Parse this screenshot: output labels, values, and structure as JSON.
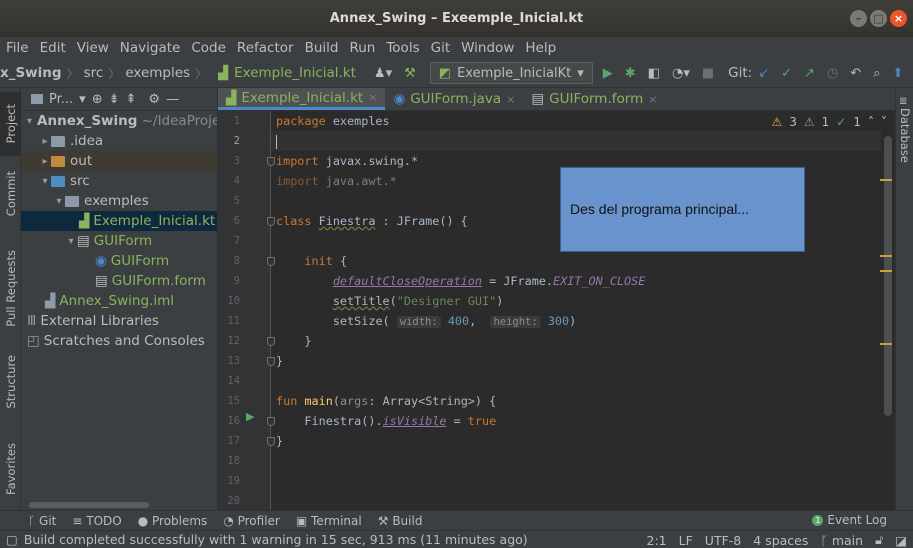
{
  "window": {
    "title": "Annex_Swing – Exeemple_Inicial.kt",
    "buttons": [
      "–",
      "□",
      "×"
    ]
  },
  "menu": [
    "File",
    "Edit",
    "View",
    "Navigate",
    "Code",
    "Refactor",
    "Build",
    "Run",
    "Tools",
    "Git",
    "Window",
    "Help"
  ],
  "breadcrumbs": [
    "x_Swing",
    "src",
    "exemples",
    "Exemple_Inicial.kt"
  ],
  "toolbar": {
    "run_config": "Exemple_InicialKt",
    "git_label": "Git:"
  },
  "left_tabs": [
    "Project",
    "Commit",
    "Pull Requests",
    "Structure",
    "Favorites"
  ],
  "project": {
    "header": "Pr...",
    "tree": [
      {
        "label": "Annex_Swing",
        "suffix": "~/IdeaProjec"
      },
      {
        "label": ".idea"
      },
      {
        "label": "out"
      },
      {
        "label": "src"
      },
      {
        "label": "exemples"
      },
      {
        "label": "Exemple_Inicial.kt"
      },
      {
        "label": "GUIForm"
      },
      {
        "label": "GUIForm"
      },
      {
        "label": "GUIForm.form"
      },
      {
        "label": "Annex_Swing.iml"
      },
      {
        "label": "External Libraries"
      },
      {
        "label": "Scratches and Consoles"
      }
    ]
  },
  "tabs": [
    {
      "label": "Exemple_Inicial.kt"
    },
    {
      "label": "GUIForm.java"
    },
    {
      "label": "GUIForm.form"
    }
  ],
  "inspections": {
    "warnings": "3",
    "weak": "1",
    "ok": "1"
  },
  "line_numbers": [
    "1",
    "2",
    "3",
    "4",
    "5",
    "6",
    "7",
    "8",
    "9",
    "10",
    "11",
    "12",
    "13",
    "14",
    "15",
    "16",
    "17",
    "18",
    "19",
    "20"
  ],
  "code": {
    "l1_kw": "package",
    "l1_rest": " exemples",
    "l3_kw": "import",
    "l3_rest": " javax.swing.*",
    "l4_kw": "import",
    "l4_rest": " java.awt.*",
    "l6_kw": "class",
    "l6_name": "Finestra",
    "l6_rest": " : JFrame() {",
    "l8_kw": "init",
    "l8_rest": " {",
    "l9_prop": "defaultCloseOperation",
    "l9_eq": " = JFrame.",
    "l9_const": "EXIT_ON_CLOSE",
    "l10_fn": "setTitle",
    "l10_str": "\"Designer GUI\"",
    "l11_fn": "setSize",
    "l11_hint1": "width:",
    "l11_v1": "400",
    "l11_hint2": "height:",
    "l11_v2": "300",
    "l12": "}",
    "l13": "}",
    "l15_kw": "fun",
    "l15_fn": "main",
    "l15_param": "args",
    "l15_rest": ": Array<String>) {",
    "l16_a": "Finestra().",
    "l16_prop": "isVisible",
    "l16_eq": " = ",
    "l16_kw": "true",
    "l17": "}"
  },
  "note": "Des del programa principal...",
  "right_tab": "Database",
  "bottom_tools": [
    "Git",
    "TODO",
    "Problems",
    "Profiler",
    "Terminal",
    "Build"
  ],
  "event_log": "Event Log",
  "status": {
    "message": "Build completed successfully with 1 warning in 15 sec, 913 ms (11 minutes ago)",
    "position": "2:1",
    "line_sep": "LF",
    "encoding": "UTF-8",
    "indent": "4 spaces",
    "branch": "main"
  }
}
